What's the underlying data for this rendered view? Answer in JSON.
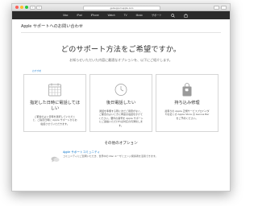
{
  "browser": {
    "url": "getsupport.apple.com",
    "back_label": "‹",
    "forward_label": "›"
  },
  "global_nav": {
    "apple_logo": "",
    "items": [
      "Mac",
      "iPad",
      "iPhone",
      "Watch",
      "TV",
      "Music",
      "サポート"
    ]
  },
  "page": {
    "header": "Apple サポートへのお問い合わせ",
    "title": "どのサポート方法をご希望ですか。",
    "subtitle": "お知らせいただいた内容に最適なオプションを、以下にご紹介します。",
    "tag": "おすすめ"
  },
  "cards": [
    {
      "icon": "calendar-icon",
      "title": "指定した日時に電話してほしい",
      "desc": "ご都合のよい日時を選択していただくと、ご指定日時に Apple サポートからお電話させていただきます。"
    },
    {
      "icon": "clock-icon",
      "title": "後日電話したい",
      "desc": "通話を準備する際にまだご用意がなく、ご都合のよいときに再度お電話をかけてください。要件の番号を Apple サポートにご連絡いただければ対応の円滑化します。"
    },
    {
      "icon": "apple-store-bag-icon",
      "title": "持ち込み修理",
      "desc": "最寄りの Apple 正規サービスプロバイダやお近くの Apple Store の Genius Bar をご予約ください。"
    }
  ],
  "other": {
    "title": "その他のオプション",
    "community_link": "Apple サポートコミュニティ",
    "community_desc": "コミュニティにご質問いただき、世界中の Mac ユーザとエンジ関係者を活用できます。"
  }
}
